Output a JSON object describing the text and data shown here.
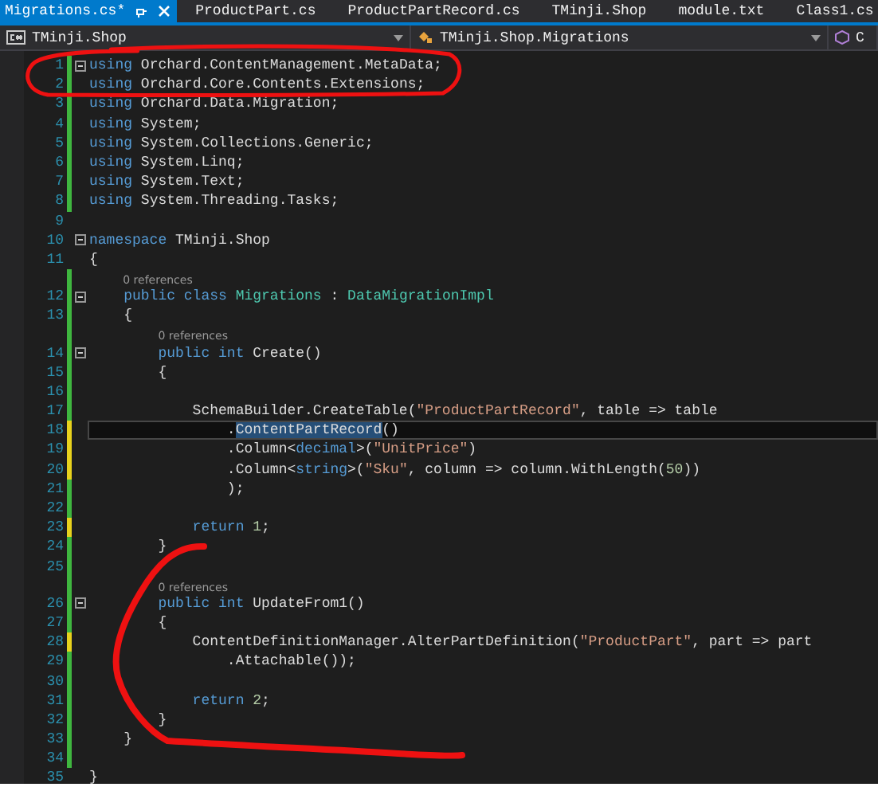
{
  "tabs": [
    {
      "label": "Migrations.cs*",
      "selected": true
    },
    {
      "label": "ProductPart.cs",
      "selected": false
    },
    {
      "label": "ProductPartRecord.cs",
      "selected": false
    },
    {
      "label": "TMinji.Shop",
      "selected": false
    },
    {
      "label": "module.txt",
      "selected": false
    },
    {
      "label": "Class1.cs",
      "selected": false
    }
  ],
  "nav": [
    {
      "label": "TMinji.Shop",
      "kind": "project"
    },
    {
      "label": "TMinji.Shop.Migrations",
      "kind": "class"
    },
    {
      "label": "C",
      "kind": "member"
    }
  ],
  "lines": [
    {
      "number": "1",
      "color": "#3fb63f",
      "foldable": true,
      "current": false,
      "tokens": [
        {
          "kind": "k",
          "text": "using"
        },
        {
          "kind": "p",
          "text": " Orchard.ContentManagement.MetaData;"
        }
      ]
    },
    {
      "number": "2",
      "color": "#3fb63f",
      "foldable": false,
      "current": false,
      "tokens": [
        {
          "kind": "k",
          "text": "using"
        },
        {
          "kind": "p",
          "text": " Orchard.Core.Contents.Extensions;"
        }
      ]
    },
    {
      "number": "3",
      "color": "#3fb63f",
      "foldable": false,
      "current": false,
      "tokens": [
        {
          "kind": "k",
          "text": "using"
        },
        {
          "kind": "p",
          "text": " Orchard.Data.Migration;"
        }
      ]
    },
    {
      "number": "4",
      "color": "#3fb63f",
      "foldable": false,
      "current": false,
      "tokens": [
        {
          "kind": "k",
          "text": "using"
        },
        {
          "kind": "p",
          "text": " System;"
        }
      ]
    },
    {
      "number": "5",
      "color": "#3fb63f",
      "foldable": false,
      "current": false,
      "tokens": [
        {
          "kind": "k",
          "text": "using"
        },
        {
          "kind": "p",
          "text": " System.Collections.Generic;"
        }
      ]
    },
    {
      "number": "6",
      "color": "#3fb63f",
      "foldable": false,
      "current": false,
      "tokens": [
        {
          "kind": "k",
          "text": "using"
        },
        {
          "kind": "p",
          "text": " System.Linq;"
        }
      ]
    },
    {
      "number": "7",
      "color": "#3fb63f",
      "foldable": false,
      "current": false,
      "tokens": [
        {
          "kind": "k",
          "text": "using"
        },
        {
          "kind": "p",
          "text": " System.Text;"
        }
      ]
    },
    {
      "number": "8",
      "color": "#3fb63f",
      "foldable": false,
      "current": false,
      "tokens": [
        {
          "kind": "k",
          "text": "using"
        },
        {
          "kind": "p",
          "text": " System.Threading.Tasks;"
        }
      ]
    },
    {
      "number": "9",
      "foldable": false,
      "current": false
    },
    {
      "number": "10",
      "foldable": true,
      "current": false,
      "tokens": [
        {
          "kind": "k",
          "text": "namespace"
        },
        {
          "kind": "p",
          "text": " TMinji.Shop"
        }
      ]
    },
    {
      "number": "11",
      "foldable": false,
      "current": false,
      "tokens": [
        {
          "kind": "p",
          "text": "{"
        }
      ]
    },
    {
      "number": "12",
      "color": "#3fb63f",
      "foldable": true,
      "current": false,
      "lens": "0 references",
      "tokens": [
        {
          "kind": "k",
          "text": "    public class"
        },
        {
          "kind": "t",
          "text": " Migrations"
        },
        {
          "kind": "p",
          "text": " : "
        },
        {
          "kind": "t",
          "text": "DataMigrationImpl"
        }
      ]
    },
    {
      "number": "13",
      "color": "#3fb63f",
      "foldable": false,
      "current": false,
      "tokens": [
        {
          "kind": "p",
          "text": "    {"
        }
      ]
    },
    {
      "number": "14",
      "color": "#3fb63f",
      "foldable": true,
      "current": false,
      "lens": "0 references",
      "tokens": [
        {
          "kind": "k",
          "text": "        public int"
        },
        {
          "kind": "p",
          "text": " Create()"
        }
      ]
    },
    {
      "number": "15",
      "color": "#3fb63f",
      "foldable": false,
      "current": false,
      "tokens": [
        {
          "kind": "p",
          "text": "        {"
        }
      ]
    },
    {
      "number": "16",
      "color": "#3fb63f",
      "foldable": false,
      "current": false
    },
    {
      "number": "17",
      "color": "#3fb63f",
      "foldable": false,
      "current": false,
      "tokens": [
        {
          "kind": "p",
          "text": "            SchemaBuilder.CreateTable("
        },
        {
          "kind": "s",
          "text": "\"ProductPartRecord\""
        },
        {
          "kind": "p",
          "text": ", table => table"
        }
      ]
    },
    {
      "number": "18",
      "color": "#e8d21d",
      "foldable": false,
      "current": true,
      "tokens": [
        {
          "kind": "p",
          "text": "                ."
        },
        {
          "kind": "selected",
          "text": "ContentPartRecord"
        },
        {
          "kind": "p",
          "text": "()"
        }
      ]
    },
    {
      "number": "19",
      "color": "#e8d21d",
      "foldable": false,
      "current": false,
      "tokens": [
        {
          "kind": "p",
          "text": "                .Column<"
        },
        {
          "kind": "k",
          "text": "decimal"
        },
        {
          "kind": "p",
          "text": ">("
        },
        {
          "kind": "s",
          "text": "\"UnitPrice\""
        },
        {
          "kind": "p",
          "text": ")"
        }
      ]
    },
    {
      "number": "20",
      "color": "#e8d21d",
      "foldable": false,
      "current": false,
      "tokens": [
        {
          "kind": "p",
          "text": "                .Column<"
        },
        {
          "kind": "k",
          "text": "string"
        },
        {
          "kind": "p",
          "text": ">("
        },
        {
          "kind": "s",
          "text": "\"Sku\""
        },
        {
          "kind": "p",
          "text": ", column => column.WithLength("
        },
        {
          "kind": "n",
          "text": "50"
        },
        {
          "kind": "p",
          "text": "))"
        }
      ]
    },
    {
      "number": "21",
      "color": "#3fb63f",
      "foldable": false,
      "current": false,
      "tokens": [
        {
          "kind": "p",
          "text": "                );"
        }
      ]
    },
    {
      "number": "22",
      "color": "#3fb63f",
      "foldable": false,
      "current": false
    },
    {
      "number": "23",
      "color": "#e8d21d",
      "foldable": false,
      "current": false,
      "tokens": [
        {
          "kind": "k",
          "text": "            return"
        },
        {
          "kind": "n",
          "text": " 1"
        },
        {
          "kind": "p",
          "text": ";"
        }
      ]
    },
    {
      "number": "24",
      "color": "#3fb63f",
      "foldable": false,
      "current": false,
      "tokens": [
        {
          "kind": "p",
          "text": "        }"
        }
      ]
    },
    {
      "number": "25",
      "color": "#3fb63f",
      "foldable": false,
      "current": false
    },
    {
      "number": "26",
      "color": "#3fb63f",
      "foldable": true,
      "current": false,
      "lens": "0 references",
      "tokens": [
        {
          "kind": "k",
          "text": "        public int"
        },
        {
          "kind": "p",
          "text": " UpdateFrom1()"
        }
      ]
    },
    {
      "number": "27",
      "color": "#3fb63f",
      "foldable": false,
      "current": false,
      "tokens": [
        {
          "kind": "p",
          "text": "        {"
        }
      ]
    },
    {
      "number": "28",
      "color": "#e8d21d",
      "foldable": false,
      "current": false,
      "tokens": [
        {
          "kind": "p",
          "text": "            ContentDefinitionManager.AlterPartDefinition("
        },
        {
          "kind": "s",
          "text": "\"ProductPart\""
        },
        {
          "kind": "p",
          "text": ", part => part"
        }
      ]
    },
    {
      "number": "29",
      "color": "#3fb63f",
      "foldable": false,
      "current": false,
      "tokens": [
        {
          "kind": "p",
          "text": "                .Attachable());"
        }
      ]
    },
    {
      "number": "30",
      "color": "#3fb63f",
      "foldable": false,
      "current": false
    },
    {
      "number": "31",
      "color": "#3fb63f",
      "foldable": false,
      "current": false,
      "tokens": [
        {
          "kind": "k",
          "text": "            return"
        },
        {
          "kind": "n",
          "text": " 2"
        },
        {
          "kind": "p",
          "text": ";"
        }
      ]
    },
    {
      "number": "32",
      "color": "#3fb63f",
      "foldable": false,
      "current": false,
      "tokens": [
        {
          "kind": "p",
          "text": "        }"
        }
      ]
    },
    {
      "number": "33",
      "color": "#3fb63f",
      "foldable": false,
      "current": false,
      "tokens": [
        {
          "kind": "p",
          "text": "    }"
        }
      ]
    },
    {
      "number": "34",
      "color": "#3fb63f",
      "foldable": false,
      "current": false
    },
    {
      "number": "35",
      "foldable": false,
      "current": false,
      "tokens": [
        {
          "kind": "p",
          "text": "}"
        }
      ]
    }
  ],
  "annotations": [
    {
      "kind": "ellipse"
    },
    {
      "kind": "curve"
    }
  ]
}
